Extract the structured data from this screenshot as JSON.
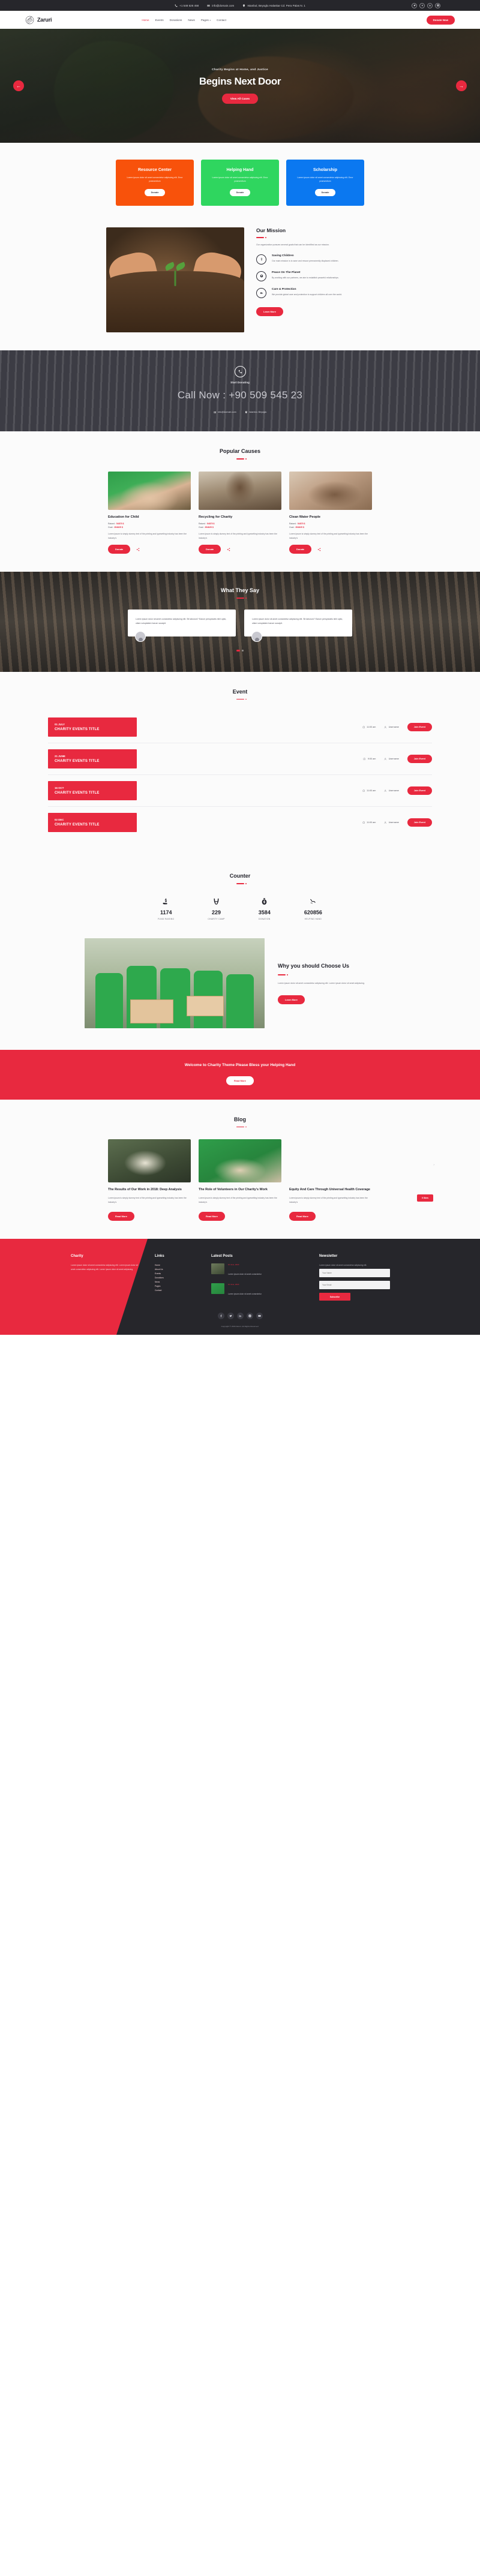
{
  "topbar": {
    "phone": "+1 548 626 458",
    "email": "info@domain.com",
    "address": "Istanbul, Beyoglu Halaskar Cd. Pera Palas N. 1",
    "socials": [
      "twitter-icon",
      "google-icon",
      "linkedin-icon",
      "instagram-icon"
    ]
  },
  "nav": {
    "brand": "Zaruri",
    "items": [
      {
        "label": "Home",
        "active": true
      },
      {
        "label": "Events",
        "active": false
      },
      {
        "label": "Donations",
        "active": false
      },
      {
        "label": "News",
        "active": false
      },
      {
        "label": "Pages",
        "active": false,
        "caret": "▾"
      },
      {
        "label": "Contact",
        "active": false
      }
    ],
    "cta": "Donate Now"
  },
  "hero": {
    "subtitle": "Charity Begins at Home, and Justice",
    "title": "Begins Next Door",
    "button": "View All Cases",
    "prev": "←",
    "next": "→"
  },
  "features": [
    {
      "title": "Resource Center",
      "text": "Lorem ipsum dolor sit amet consectetur adipiscing elit. Error praesentium",
      "button": "Donate",
      "color": "#f8520b"
    },
    {
      "title": "Helping Hand",
      "text": "Lorem ipsum dolor sit amet consectetur adipiscing elit. Error praesentium",
      "button": "Donate",
      "color": "#2fd65f"
    },
    {
      "title": "Scholarship",
      "text": "Lorem ipsum dolor sit amet consectetur adipiscing elit. Error praesentium",
      "button": "Donate",
      "color": "#0b78f0"
    }
  ],
  "mission": {
    "title": "Our Mission",
    "lead": "Our organization pursues several goals that can be identified as our mission.",
    "items": [
      {
        "icon": "child-icon",
        "title": "Saving Children",
        "text": "Our main mission is to save and rescue permanently displaced children."
      },
      {
        "icon": "planet-icon",
        "title": "Peace On The Planet",
        "text": "By working with our partners, we aim to establish peaceful relationships."
      },
      {
        "icon": "care-hands-icon",
        "title": "Care & Protection",
        "text": "We provide global care and protection to support children all over the world."
      }
    ],
    "button": "Learn More"
  },
  "callband": {
    "icon": "phone-icon",
    "subtitle": "Start Donating",
    "number": "Call Now : +90 509 545 23",
    "email": "info@domain.com",
    "address": "Istanbul, Beyoglu"
  },
  "causes": {
    "heading": "Popular Causes",
    "items": [
      {
        "title": "Education for Child",
        "raised_label": "Raised :",
        "raised": "54875 $",
        "goal_label": "Goal :",
        "goal": "354825 $",
        "text": "Lorem Ipsum is simply dummy text of the printing and typesetting industry has been the industry's",
        "button": "Donate"
      },
      {
        "title": "Recycling for Charity",
        "raised_label": "Raised :",
        "raised": "54875 $",
        "goal_label": "Goal :",
        "goal": "354825 $",
        "text": "Lorem Ipsum is simply dummy text of the printing and typesetting industry has been the industry's",
        "button": "Donate"
      },
      {
        "title": "Clean Water People",
        "raised_label": "Raised :",
        "raised": "54875 $",
        "goal_label": "Goal :",
        "goal": "354825 $",
        "text": "Lorem Ipsum is simply dummy text of the printing and typesetting industry has been the industry's",
        "button": "Donate"
      }
    ]
  },
  "testimonials": {
    "heading": "What They Say",
    "items": [
      {
        "text": "Lorem ipsum dolor sit amet consectetur adipiscing elit. Sit laborum? Earum perspiciatis nihil optio, ullam voluptatem harum suscipit."
      },
      {
        "text": "Lorem ipsum dolor sit amet consectetur adipiscing elit. Sit laborum? Earum perspiciatis nihil optio, ullam voluptatem harum suscipit."
      }
    ]
  },
  "events": {
    "heading": "Event",
    "items": [
      {
        "date": "01 JULY",
        "title": "CHARITY EVENTS TITLE",
        "time": "11:00 am",
        "user": "Username",
        "button": "Join Event"
      },
      {
        "date": "21 JUNE",
        "title": "CHARITY EVENTS TITLE",
        "time": "9:00 am",
        "user": "Username",
        "button": "Join Event"
      },
      {
        "date": "16 OCT",
        "title": "CHARITY EVENTS TITLE",
        "time": "11:00 am",
        "user": "Username",
        "button": "Join Event"
      },
      {
        "date": "02 DEC",
        "title": "CHARITY EVENTS TITLE",
        "time": "11:00 am",
        "user": "Username",
        "button": "Join Event"
      }
    ]
  },
  "counter": {
    "heading": "Counter",
    "items": [
      {
        "icon": "hand-money-icon",
        "value": "1174",
        "label": "FUND RAISING"
      },
      {
        "icon": "open-hands-icon",
        "value": "229",
        "label": "CHARITY CAMP"
      },
      {
        "icon": "money-bag-icon",
        "value": "3584",
        "label": "DONATION"
      },
      {
        "icon": "helping-hand-icon",
        "value": "620856",
        "label": "HELPING HAND"
      }
    ]
  },
  "why": {
    "title": "Why you should Choose Us",
    "text": "Lorem ipsum dolor sit amet consectetur adipiscing elit. Lorem ipsum dolor sit amet adipiscing.",
    "button": "Learn More"
  },
  "cta": {
    "title": "Welcome to Charity Theme Please Bless your Helping Hand",
    "button": "Read More"
  },
  "blog": {
    "heading": "Blog",
    "badge": "0 likes",
    "prev": "‹",
    "next": "›",
    "posts": [
      {
        "title": "The Results of Our Work in 2018: Deep Analysis",
        "text": "Lorem ipsum is simply dummy text of the printing and typesetting industry has been the industry's",
        "button": "Read More"
      },
      {
        "title": "The Role of Volunteers in Our Charity's Work",
        "text": "Lorem ipsum is simply dummy text of the printing and typesetting industry has been the industry's",
        "button": "Read More"
      },
      {
        "title": "Equity And Care Through Universal Health Coverage",
        "text": "Lorem ipsum is simply dummy text of the printing and typesetting industry has been the industry's",
        "button": "Read More"
      }
    ]
  },
  "footer": {
    "about": {
      "title": "Charity",
      "text": "Lorem ipsum dolor sit amet consectetur adipiscing elit. Lorem ipsum dolor sit amet consectetur adipiscing elit. Lorem ipsum dolor sit amet adipiscing."
    },
    "links": {
      "title": "Links",
      "items": [
        "Home",
        "About Us",
        "Events",
        "Donations",
        "News",
        "Pages",
        "Contact"
      ]
    },
    "latest": {
      "title": "Latest Posts",
      "items": [
        {
          "date": "10 June, 2020",
          "text": "Lorem ipsum dolor sit amet consectetur"
        },
        {
          "date": "10 June, 2020",
          "text": "Lorem ipsum dolor sit amet consectetur"
        }
      ]
    },
    "newsletter": {
      "title": "Newsletter",
      "text": "Lorem ipsum dolor sit amet consectetur adipiscing elit.",
      "name_placeholder": "Your Name",
      "email_placeholder": "Your Email",
      "button": "Subscribe"
    },
    "socials": [
      "facebook-icon",
      "twitter-icon",
      "linkedin-icon",
      "instagram-icon",
      "youtube-icon"
    ],
    "copyright": "Copyright © 2020 Zaruri. All Rights Reserved."
  }
}
